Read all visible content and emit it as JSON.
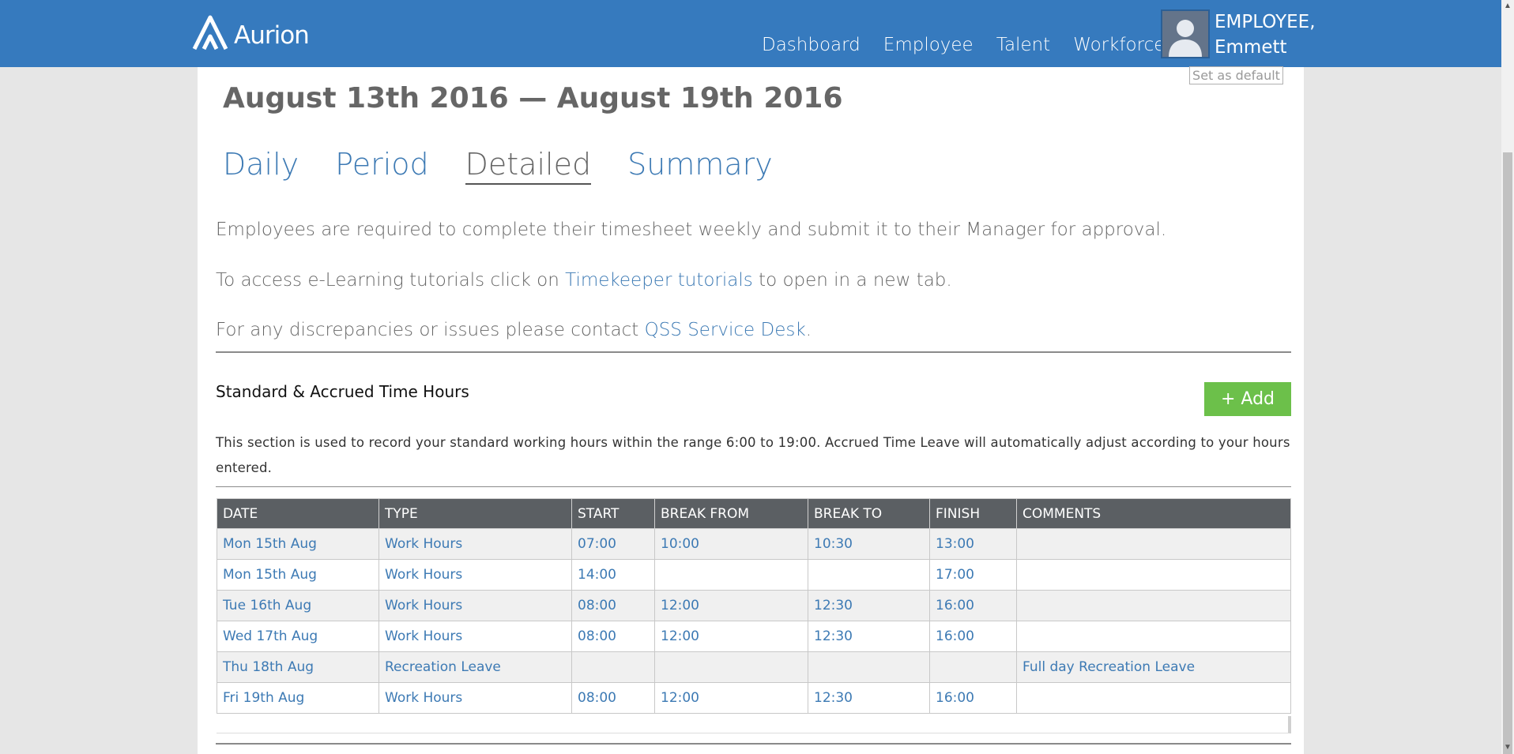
{
  "header": {
    "logo_text": "Aurion",
    "nav": [
      "Dashboard",
      "Employee",
      "Talent",
      "Workforce"
    ],
    "user_line1": "EMPLOYEE,",
    "user_line2": "Emmett"
  },
  "set_default_label": "Set as default",
  "page_title": "August 13th 2016 — August 19th 2016",
  "tabs": [
    {
      "label": "Daily",
      "active": false
    },
    {
      "label": "Period",
      "active": false
    },
    {
      "label": "Detailed",
      "active": true
    },
    {
      "label": "Summary",
      "active": false
    }
  ],
  "info": {
    "line1": "Employees are required to complete their timesheet weekly and submit it to their Manager for approval.",
    "line2_pre": "To access e-Learning tutorials click on ",
    "line2_link": "Timekeeper tutorials",
    "line2_post": " to open in a new tab.",
    "line3_pre": "For any discrepancies or issues please contact ",
    "line3_link": "QSS Service Desk",
    "line3_post": "."
  },
  "section": {
    "title": "Standard & Accrued Time Hours",
    "add_label": "+ Add",
    "description": "This section is used to record your standard working hours within the range 6:00 to 19:00. Accrued Time Leave will automatically adjust according to your hours entered."
  },
  "table": {
    "headers": [
      "DATE",
      "TYPE",
      "START",
      "BREAK FROM",
      "BREAK TO",
      "FINISH",
      "COMMENTS"
    ],
    "rows": [
      [
        "Mon 15th Aug",
        "Work Hours",
        "07:00",
        "10:00",
        "10:30",
        "13:00",
        ""
      ],
      [
        "Mon 15th Aug",
        "Work Hours",
        "14:00",
        "",
        "",
        "17:00",
        ""
      ],
      [
        "Tue 16th Aug",
        "Work Hours",
        "08:00",
        "12:00",
        "12:30",
        "16:00",
        ""
      ],
      [
        "Wed 17th Aug",
        "Work Hours",
        "08:00",
        "12:00",
        "12:30",
        "16:00",
        ""
      ],
      [
        "Thu 18th Aug",
        "Recreation Leave",
        "",
        "",
        "",
        "",
        "Full day Recreation Leave"
      ],
      [
        "Fri 19th Aug",
        "Work Hours",
        "08:00",
        "12:00",
        "12:30",
        "16:00",
        ""
      ]
    ]
  },
  "colors": {
    "header_bg": "#367abe",
    "link": "#3d7ab4",
    "add_button": "#6cc04a",
    "table_header": "#5b5f63"
  }
}
